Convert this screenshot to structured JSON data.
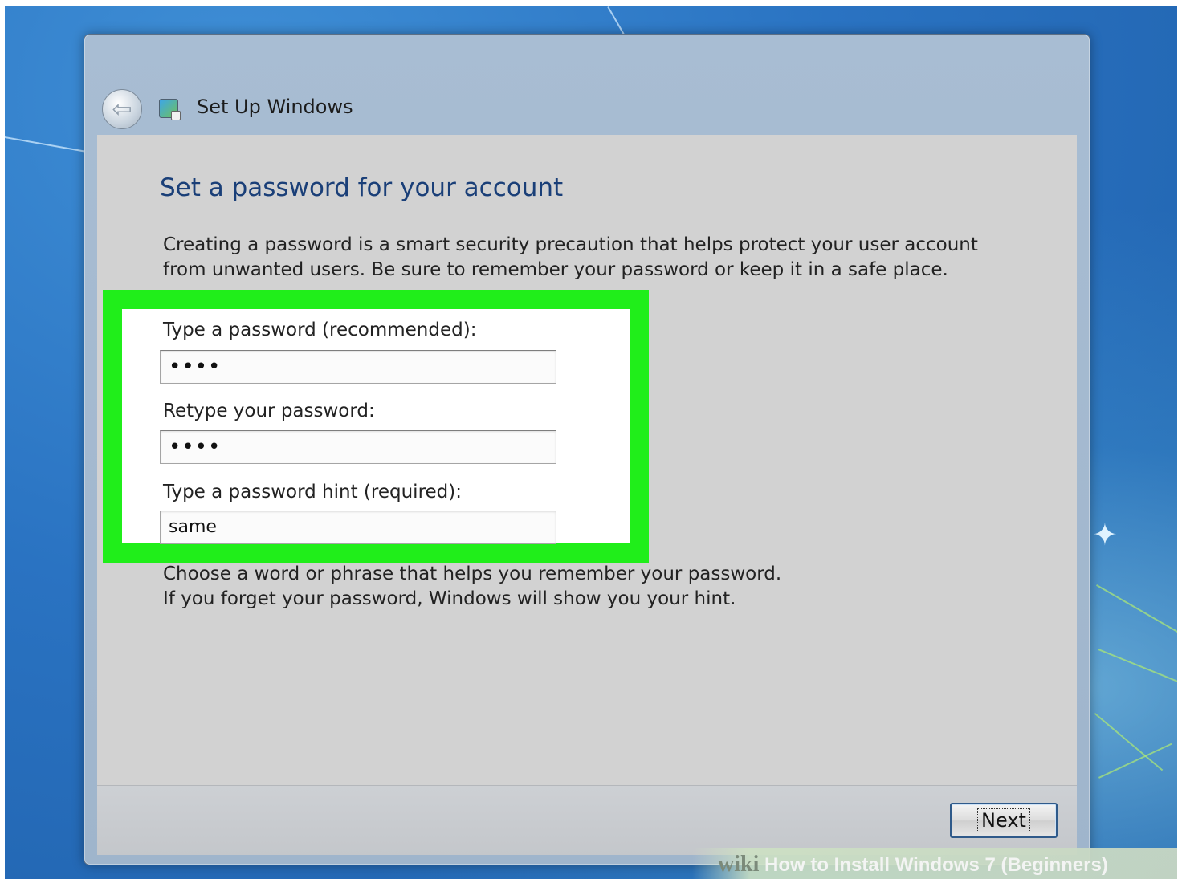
{
  "window": {
    "title": "Set Up Windows",
    "back_icon": "back-arrow-icon",
    "app_icon": "setup-windows-icon"
  },
  "page": {
    "heading": "Set a password for your account",
    "description": "Creating a password is a smart security precaution that helps protect your user account from unwanted users. Be sure to remember your password or keep it in a safe place."
  },
  "form": {
    "password_label": "Type a password (recommended):",
    "password_value": "••••",
    "retype_label": "Retype your password:",
    "retype_value": "••••",
    "hint_label": "Type a password hint (required):",
    "hint_value": "same",
    "hint_help_line1": "Choose a word or phrase that helps you remember your password.",
    "hint_help_line2": "If you forget your password, Windows will show you your hint."
  },
  "footer": {
    "next_label": "Next"
  },
  "watermark": {
    "brand": "wiki",
    "text": "How to Install Windows 7 (Beginners)"
  },
  "colors": {
    "highlight": "#20ee1a",
    "heading": "#1a3f78",
    "content_bg": "#d2d2d2"
  }
}
